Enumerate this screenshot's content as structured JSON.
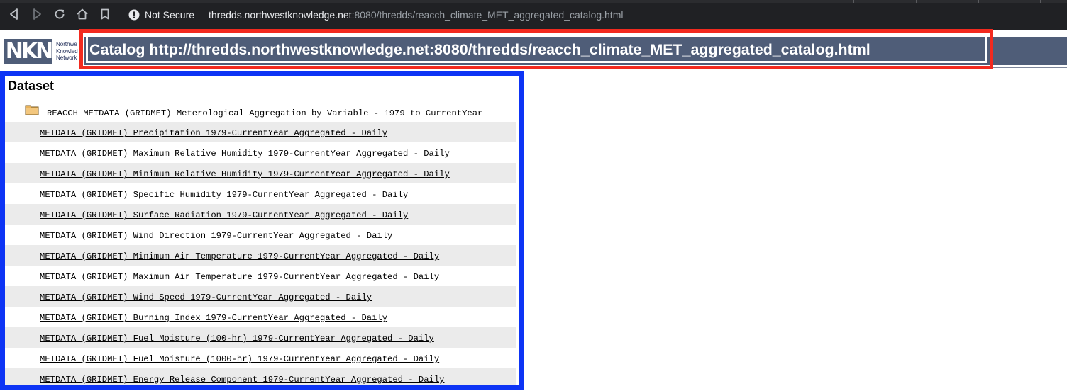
{
  "browser": {
    "security_label": "Not Secure",
    "url_host": "thredds.northwestknowledge.net",
    "url_rest": ":8080/thredds/reacch_climate_MET_aggregated_catalog.html"
  },
  "header": {
    "logo_text": "NKN",
    "logo_caption": [
      "Northwe",
      "Knowled",
      "Network"
    ],
    "title": "Catalog http://thredds.northwestknowledge.net:8080/thredds/reacch_climate_MET_aggregated_catalog.html"
  },
  "table": {
    "heading": "Dataset",
    "folder_label": "REACCH METDATA (GRIDMET) Meterological Aggregation by Variable - 1979 to CurrentYear",
    "rows": [
      "METDATA (GRIDMET) Precipitation 1979-CurrentYear Aggregated - Daily",
      "METDATA (GRIDMET) Maximum Relative Humidity 1979-CurrentYear Aggregated - Daily",
      "METDATA (GRIDMET) Minimum Relative Humidity 1979-CurrentYear Aggregated - Daily",
      "METDATA (GRIDMET) Specific Humidity 1979-CurrentYear Aggregated - Daily",
      "METDATA (GRIDMET) Surface Radiation 1979-CurrentYear Aggregated - Daily",
      "METDATA (GRIDMET) Wind Direction 1979-CurrentYear Aggregated - Daily",
      "METDATA (GRIDMET) Minimum Air Temperature 1979-CurrentYear Aggregated - Daily",
      "METDATA (GRIDMET) Maximum Air Temperature 1979-CurrentYear Aggregated - Daily",
      "METDATA (GRIDMET) Wind Speed 1979-CurrentYear Aggregated - Daily",
      "METDATA (GRIDMET) Burning Index 1979-CurrentYear Aggregated - Daily",
      "METDATA (GRIDMET) Fuel Moisture (100-hr) 1979-CurrentYear Aggregated - Daily",
      "METDATA (GRIDMET) Fuel Moisture (1000-hr) 1979-CurrentYear Aggregated - Daily",
      "METDATA (GRIDMET) Energy Release Component 1979-CurrentYear Aggregated - Daily"
    ]
  },
  "colors": {
    "header_bar": "#4f5d78",
    "highlight_red": "#f22a1f",
    "highlight_blue": "#0d34f5",
    "row_shade": "#ebebeb"
  },
  "icons": [
    "back-icon",
    "forward-icon",
    "reload-icon",
    "home-icon",
    "bookmark-icon",
    "info-icon",
    "folder-icon"
  ]
}
